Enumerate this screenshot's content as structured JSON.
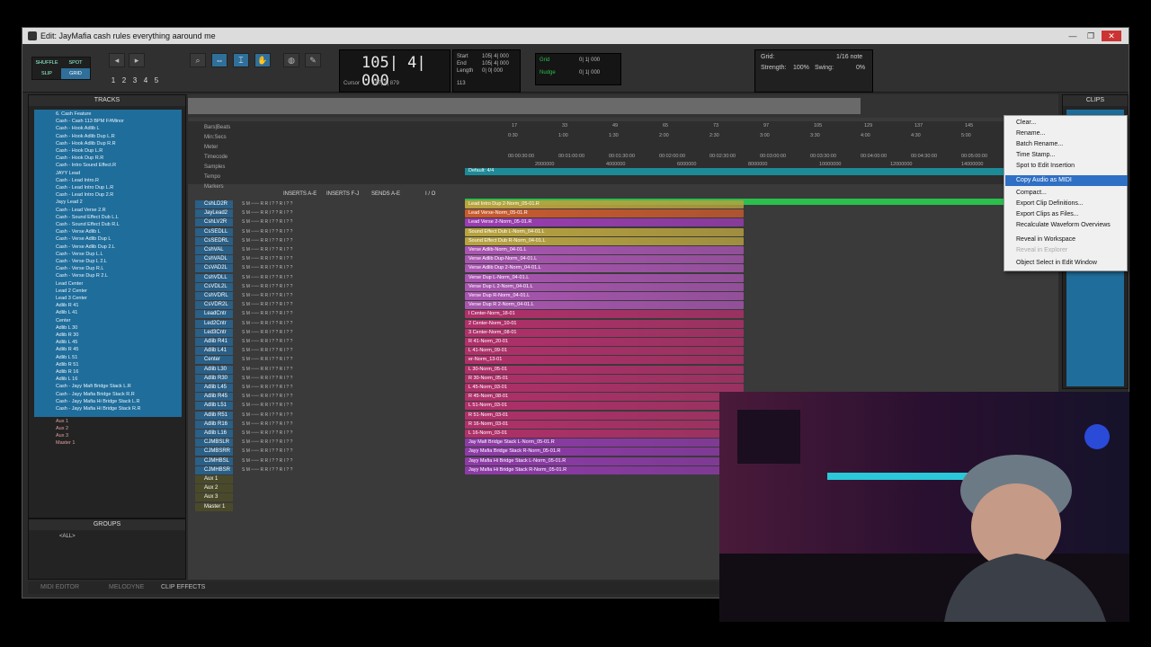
{
  "window": {
    "title": "Edit: JayMafia cash rules everything aaround me",
    "min": "—",
    "max": "❐",
    "close": "✕"
  },
  "toolbar": {
    "modes": [
      "SHUFFLE",
      "SPOT",
      "SLIP",
      "GRID"
    ],
    "zoom_presets": [
      "1",
      "2",
      "3",
      "4",
      "5"
    ],
    "counter": {
      "main": "105| 4| 000",
      "cursor_label": "Cursor",
      "cursor_value": "167| 4| 879",
      "value_113": "113"
    },
    "selection": {
      "start_label": "Start",
      "end_label": "End",
      "length_label": "Length",
      "start": "105| 4| 000",
      "end": "105| 4| 000",
      "length": "0| 0| 000"
    },
    "grid_nudge": {
      "grid_label": "Grid",
      "nudge_label": "Nudge",
      "grid_value": "0| 1| 000",
      "nudge_value": "0| 1| 000"
    },
    "right": {
      "grid_label": "Grid:",
      "grid_value": "1/16 note",
      "strength_label": "Strength:",
      "strength_value": "100%",
      "swing_label": "Swing:",
      "swing_value": "0%"
    }
  },
  "tracks_panel": {
    "title": "TRACKS",
    "items": [
      "6. Cash Feature",
      "Cash - Cash 113 BPM F#Minor",
      "Cash - Hook Adlib L",
      "Cash - Hook Adlib Dup L.R",
      "Cash - Hook Adlib Dup R.R",
      "Cash - Hook Dup L.R",
      "Cash - Hook Dup R.R",
      "Cash - Intro Sound Effect.R",
      "JAYY Lead",
      "Cash - Lead Intro.R",
      "Cash - Lead Intro Dup L.R",
      "Cash - Lead Intro Dup 2.R",
      "Jayy Lead 2",
      "Cash - Lead Verse 2.R",
      "Cash - Sound Effect Dub L.L",
      "Cash - Sound Effect Dub R.L",
      "Cash - Verse Adlib L",
      "Cash - Verse Adlib Dup L",
      "Cash - Verse Adlib Dup 2.L",
      "Cash - Verse Dup L.L",
      "Cash - Verse Dup L 2.L",
      "Cash - Verse Dup R.L",
      "Cash - Verse Dup R 2.L",
      "Lead Center",
      "Lead 2 Center",
      "Lead 3 Center",
      "Adlib R 41",
      "Adlib L 41",
      "Center",
      "Adlib L 30",
      "Adlib R 30",
      "Adlib L 45",
      "Adlib R 45",
      "Adlib L 51",
      "Adlib R 51",
      "Adlib R 16",
      "Adlib L 16",
      "Cash - Jayy Mafi Bridge Stack L.R",
      "Cash - Jayy Mafia Bridge Stack R.R",
      "Cash - Jayy Mafia Hi Bridge Stack L.R",
      "Cash - Jayy Mafia Hi Bridge Stack R.R"
    ],
    "aux": [
      "Aux 1",
      "Aux 2",
      "Aux 3",
      "Master 1"
    ]
  },
  "groups_panel": {
    "title": "GROUPS",
    "all": "<ALL>"
  },
  "rulers": {
    "labels": [
      "Bars|Beats",
      "Min:Secs",
      "Meter",
      "Timecode",
      "Samples",
      "Tempo",
      "Markers"
    ],
    "bars": [
      "17",
      "33",
      "49",
      "65",
      "73",
      "97",
      "105",
      "129",
      "137",
      "145"
    ],
    "mins": [
      "0:30",
      "1:00",
      "1:30",
      "2:00",
      "2:30",
      "3:00",
      "3:30",
      "4:00",
      "4:30",
      "5:00"
    ],
    "timecode": [
      "00:00:30:00",
      "00:01:00:00",
      "00:01:30:00",
      "00:02:00:00",
      "00:02:30:00",
      "00:03:00:00",
      "00:03:30:00",
      "00:04:00:00",
      "00:04:30:00",
      "00:05:00:00"
    ],
    "samples": [
      "2000000",
      "4000000",
      "6000000",
      "8000000",
      "10000000",
      "12000000",
      "14000000"
    ],
    "meter_text": "Default: 4/4",
    "column_headers": [
      "INSERTS A-E",
      "INSERTS F-J",
      "SENDS A-E",
      "I / O"
    ]
  },
  "track_rows": [
    {
      "name": "CshLD2R",
      "clip": "Lead Intro Dup 2-Norm_05-01.R",
      "color": "#b8a340"
    },
    {
      "name": "JayLead2",
      "clip": "Lead Verse-Norm_05-01.R",
      "color": "#c95a2e"
    },
    {
      "name": "CshLV2R",
      "clip": "Lead Verse 2-Norm_05-01.R",
      "color": "#9a3db0"
    },
    {
      "name": "CsSEDLL",
      "clip": "Sound Effect Dub L-Norm_04-01.L",
      "color": "#b8a340"
    },
    {
      "name": "CsSEDRL",
      "clip": "Sound Effect Dub R-Norm_04-01.L",
      "color": "#b8a340"
    },
    {
      "name": "CshVAL",
      "clip": "Verse Adlib-Norm_04-01.L",
      "color": "#a855b0"
    },
    {
      "name": "CshVADL",
      "clip": "Verse Adlib Dup-Norm_04-01.L",
      "color": "#a855b0"
    },
    {
      "name": "CsVAD2L",
      "clip": "Verse Adlib Dup 2-Norm_04-01.L",
      "color": "#a855b0"
    },
    {
      "name": "CshVDLL",
      "clip": "Verse Dup L-Norm_04-01.L",
      "color": "#a855b0"
    },
    {
      "name": "CsVDL2L",
      "clip": "Verse Dup L 2-Norm_04-01.L",
      "color": "#a855b0"
    },
    {
      "name": "CshVDRL",
      "clip": "Verse Dup R-Norm_04-01.L",
      "color": "#a855b0"
    },
    {
      "name": "CsVDR2L",
      "clip": "Verse Dup R 2-Norm_04-01.L",
      "color": "#a855b0"
    },
    {
      "name": "LeadCntr",
      "clip": "l Center-Norm_18-01",
      "color": "#b0306a"
    },
    {
      "name": "Led2Cntr",
      "clip": "2 Center-Norm_10-01",
      "color": "#b0306a"
    },
    {
      "name": "Led3Cntr",
      "clip": "3 Center-Norm_08-01",
      "color": "#b0306a"
    },
    {
      "name": "Adlib R41",
      "clip": "R 41-Norm_20-01",
      "color": "#b0306a"
    },
    {
      "name": "Adlib L41",
      "clip": "L 41-Norm_09-01",
      "color": "#b0306a"
    },
    {
      "name": "Center",
      "clip": "er-Norm_13-01",
      "color": "#b0306a"
    },
    {
      "name": "Adlib L30",
      "clip": "L 30-Norm_05-01",
      "color": "#b0306a"
    },
    {
      "name": "Adlib R30",
      "clip": "R 30-Norm_05-01",
      "color": "#b0306a"
    },
    {
      "name": "Adlib L45",
      "clip": "L 45-Norm_03-01",
      "color": "#b0306a"
    },
    {
      "name": "Adlib R45",
      "clip": "R 45-Norm_08-01",
      "color": "#b0306a"
    },
    {
      "name": "Adlib L51",
      "clip": "L 51-Norm_03-01",
      "color": "#b0306a"
    },
    {
      "name": "Adlib R51",
      "clip": "R 51-Norm_03-01",
      "color": "#b0306a"
    },
    {
      "name": "Adlib R16",
      "clip": "R 16-Norm_03-01",
      "color": "#b0306a"
    },
    {
      "name": "Adlib L16",
      "clip": "L 16-Norm_03-01",
      "color": "#b0306a"
    },
    {
      "name": "CJMBSLR",
      "clip": "Jay Mafi Bridge Stack L-Norm_05-01.R",
      "color": "#8e3aa8"
    },
    {
      "name": "CJMBSRR",
      "clip": "Jayy Mafia Bridge Stack R-Norm_05-01.R",
      "color": "#8e3aa8"
    },
    {
      "name": "CJMHBSL",
      "clip": "Jayy Mafia Hi Bridge Stack L-Norm_05-01.R",
      "color": "#8e3aa8"
    },
    {
      "name": "CJMHBSR",
      "clip": "Jayy Mafia Hi Bridge Stack R-Norm_05-01.R",
      "color": "#8e3aa8"
    }
  ],
  "aux_rows": [
    "Aux 1",
    "Aux 2",
    "Aux 3",
    "Master 1"
  ],
  "clips_panel": {
    "title": "CLIPS"
  },
  "context_menu": {
    "items": [
      {
        "label": "Clear...",
        "state": "normal"
      },
      {
        "label": "Rename...",
        "state": "normal"
      },
      {
        "label": "Batch Rename...",
        "state": "normal"
      },
      {
        "label": "Time Stamp...",
        "state": "normal"
      },
      {
        "label": "Spot to Edit Insertion",
        "state": "normal"
      },
      {
        "label": "Copy Audio as MIDI",
        "state": "selected"
      },
      {
        "label": "Compact...",
        "state": "normal"
      },
      {
        "label": "Export Clip Definitions...",
        "state": "normal"
      },
      {
        "label": "Export Clips as Files...",
        "state": "normal"
      },
      {
        "label": "Recalculate Waveform Overviews",
        "state": "normal"
      },
      {
        "label": "Reveal in Workspace",
        "state": "normal"
      },
      {
        "label": "Reveal in Explorer",
        "state": "disabled"
      },
      {
        "label": "Object Select in Edit Window",
        "state": "normal"
      }
    ]
  },
  "bottom_tabs": [
    "MIDI EDITOR",
    "MELODYNE",
    "CLIP EFFECTS"
  ]
}
